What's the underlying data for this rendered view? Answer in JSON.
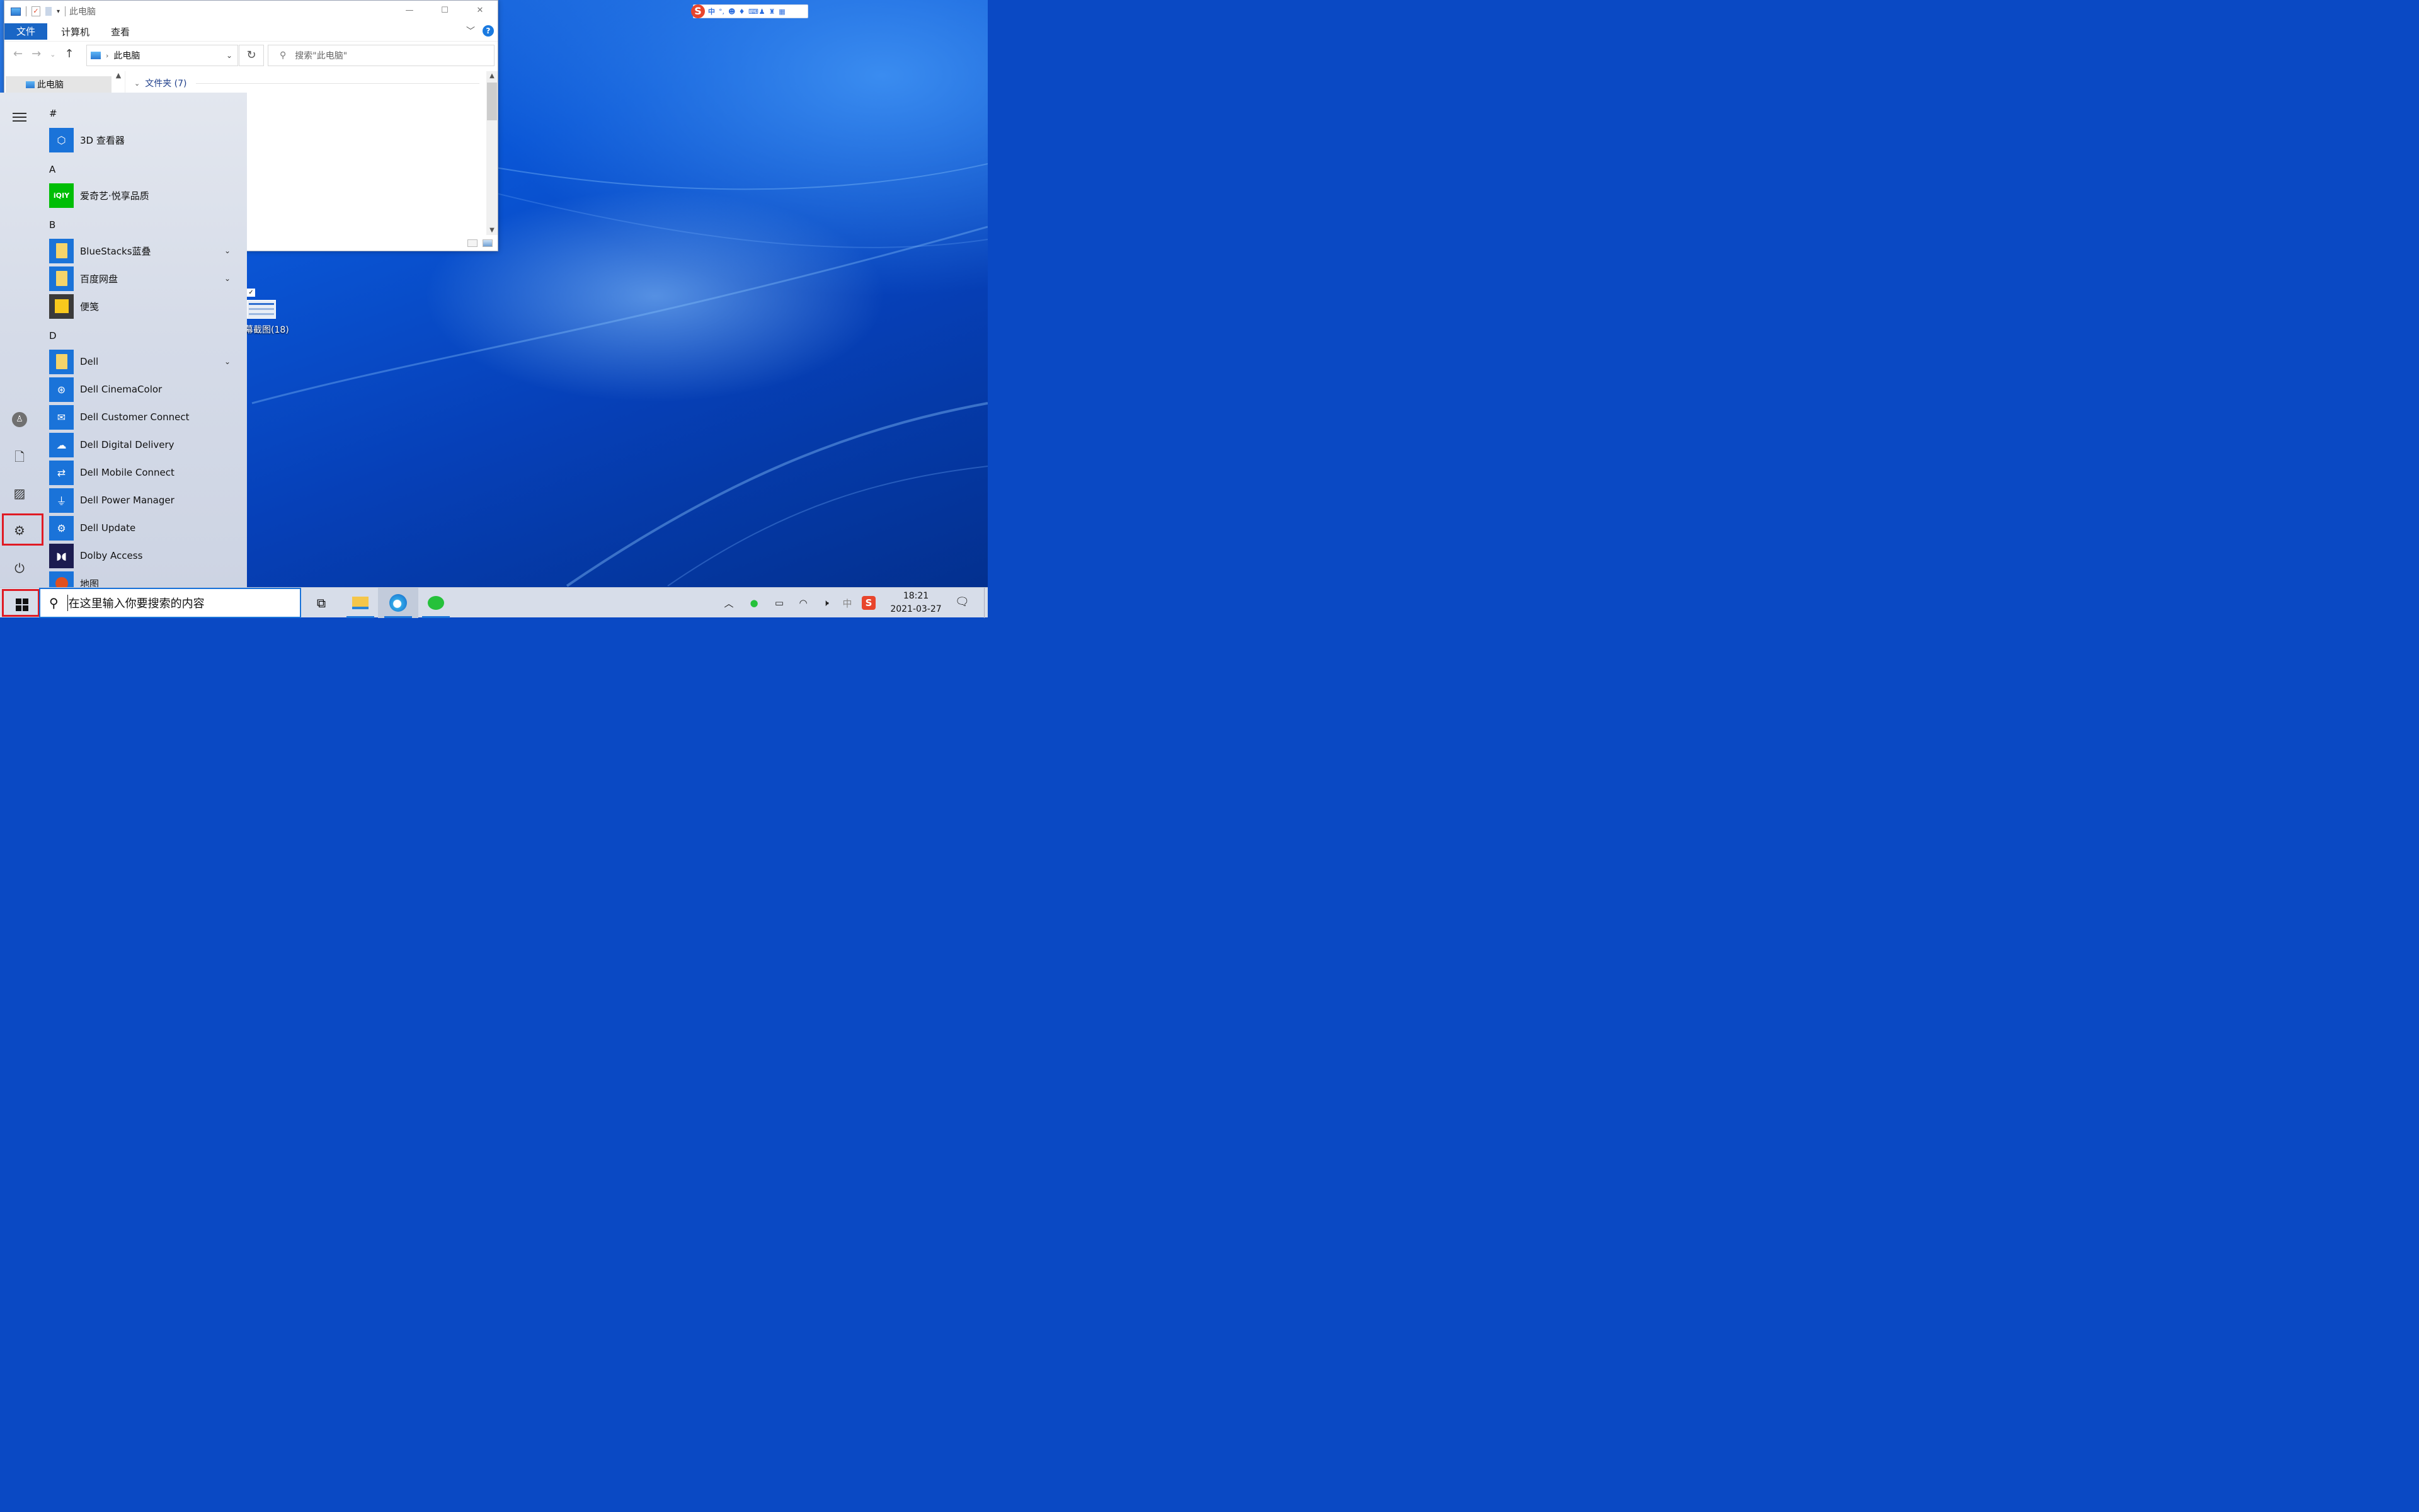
{
  "explorer": {
    "title": "此电脑",
    "window_buttons": [
      "—",
      "☐",
      "✕"
    ],
    "ribbon_tabs": [
      {
        "label": "文件"
      },
      {
        "label": "计算机"
      },
      {
        "label": "查看"
      }
    ],
    "help_label": "?",
    "address": "此电脑",
    "search_placeholder": "搜索\"此电脑\"",
    "nav_item": "此电脑",
    "group_header": "文件夹 (7)"
  },
  "ime": {
    "logo": "S",
    "mode": "中"
  },
  "desktop_icon": {
    "label": "幕截图(18)"
  },
  "start_menu": {
    "sections": [
      {
        "letter": "#",
        "apps": [
          {
            "name": "3D 查看器",
            "icon": "cube-icon"
          }
        ]
      },
      {
        "letter": "A",
        "apps": [
          {
            "name": "爱奇艺·悦享品质",
            "icon": "iqiyi-icon"
          }
        ]
      },
      {
        "letter": "B",
        "apps": [
          {
            "name": "BlueStacks蓝叠",
            "icon": "folder-icon",
            "expandable": true
          },
          {
            "name": "百度网盘",
            "icon": "folder-icon",
            "expandable": true
          },
          {
            "name": "便笺",
            "icon": "sticky-notes-icon"
          }
        ]
      },
      {
        "letter": "D",
        "apps": [
          {
            "name": "Dell",
            "icon": "folder-icon",
            "expandable": true
          },
          {
            "name": "Dell CinemaColor",
            "icon": "cinemacolor-icon"
          },
          {
            "name": "Dell Customer Connect",
            "icon": "chat-icon"
          },
          {
            "name": "Dell Digital Delivery",
            "icon": "cloud-download-icon"
          },
          {
            "name": "Dell Mobile Connect",
            "icon": "mobile-connect-icon"
          },
          {
            "name": "Dell Power Manager",
            "icon": "plug-icon"
          },
          {
            "name": "Dell Update",
            "icon": "update-gear-icon"
          },
          {
            "name": "Dolby Access",
            "icon": "dolby-icon"
          },
          {
            "name": "地图",
            "icon": "map-icon"
          }
        ]
      }
    ],
    "rail": [
      "hamburger-icon",
      "user-icon",
      "document-icon",
      "pictures-icon",
      "settings-icon",
      "power-icon"
    ]
  },
  "taskbar": {
    "search_placeholder": "在这里输入你要搜索的内容",
    "time": "18:21",
    "date": "2021-03-27",
    "ime_indicator": "中"
  },
  "colors": {
    "accent": "#1a73d9",
    "highlight_box": "#e01b24",
    "desktop": "#0a49c4"
  }
}
